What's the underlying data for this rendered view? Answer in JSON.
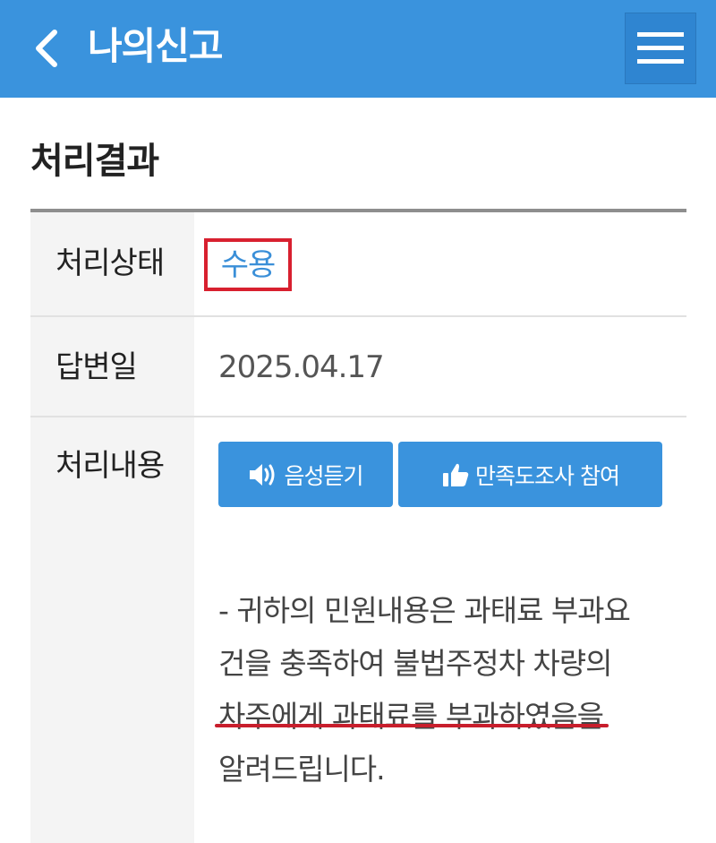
{
  "header": {
    "title": "나의신고",
    "back_icon": "chevron-left-icon",
    "menu_icon": "hamburger-menu-icon",
    "background_color": "#3a93dd"
  },
  "section": {
    "title": "처리결과"
  },
  "rows": {
    "status": {
      "label": "처리상태",
      "value": "수용",
      "value_color": "#3a8fd8",
      "highlight_color": "#d8202f"
    },
    "answer_date": {
      "label": "답변일",
      "value": "2025.04.17"
    },
    "content": {
      "label": "처리내용",
      "buttons": {
        "voice": {
          "label": "음성듣기",
          "icon": "speaker-icon"
        },
        "survey": {
          "label": "만족도조사 참여",
          "icon": "thumbs-up-icon"
        }
      },
      "text_lines": [
        "- 귀하의 민원내용은 과태료 부과요",
        "건을 충족하여 불법주정차 차량의",
        "차주에게 과태료를 부과하였음을",
        "알려드립니다."
      ],
      "underline_color": "#c81e2c"
    }
  }
}
